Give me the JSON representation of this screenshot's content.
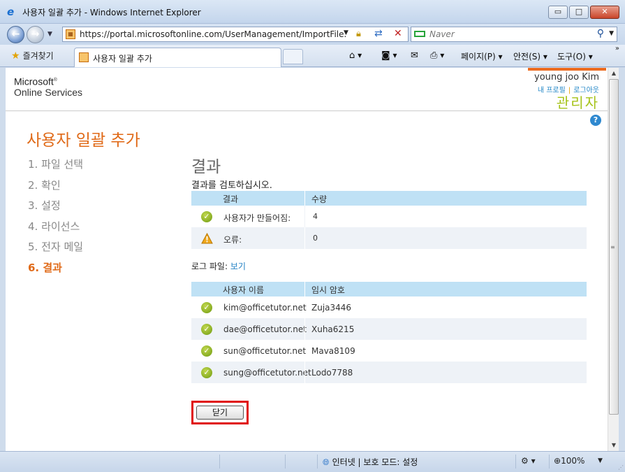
{
  "window": {
    "title": "사용자 일괄 추가 - Windows Internet Explorer",
    "minimize": "▭",
    "maximize": "□",
    "close": "✕"
  },
  "addressbar": {
    "url": "https://portal.microsoftonline.com/UserManagement/ImportFile.aspx",
    "search_placeholder": "Naver"
  },
  "favbar": {
    "favorites_label": "즐겨찾기",
    "tab_title": "사용자 일괄 추가",
    "page_menu": "페이지(P) ▾",
    "safety_menu": "안전(S) ▾",
    "tools_menu": "도구(O) ▾"
  },
  "header": {
    "logo_line1": "Microsoft",
    "logo_mark": "®",
    "logo_line2": "Online Services",
    "user_name": "young joo Kim",
    "profile_link": "내 프로필",
    "signout_link": "로그아웃",
    "role": "관리자",
    "help": "?"
  },
  "wizard": {
    "title": "사용자 일괄 추가",
    "steps": [
      {
        "label": "1. 파일 선택",
        "active": false
      },
      {
        "label": "2. 확인",
        "active": false
      },
      {
        "label": "3. 설정",
        "active": false
      },
      {
        "label": "4. 라이선스",
        "active": false
      },
      {
        "label": "5. 전자 메일",
        "active": false
      },
      {
        "label": "6. 결과",
        "active": true
      }
    ]
  },
  "results": {
    "title": "결과",
    "subtitle": "결과를 검토하십시오.",
    "summary": {
      "col_result": "결과",
      "col_count": "수량",
      "rows": [
        {
          "status": "ok",
          "label": "사용자가 만들어짐:",
          "count": "4"
        },
        {
          "status": "warning",
          "label": "오류:",
          "count": "0"
        }
      ]
    },
    "log_label": "로그 파일:",
    "log_link": "보기",
    "users": {
      "col_name": "사용자 이름",
      "col_password": "임시 암호",
      "rows": [
        {
          "name": "kim@officetutor.net",
          "password": "Zuja3446"
        },
        {
          "name": "dae@officetutor.net",
          "password": "Xuha6215"
        },
        {
          "name": "sun@officetutor.net",
          "password": "Mava8109"
        },
        {
          "name": "sung@officetutor.net",
          "password": "Lodo7788"
        }
      ]
    },
    "close_button": "닫기"
  },
  "statusbar": {
    "zone": "인터넷 | 보호 모드: 설정",
    "zoom": "100%"
  },
  "colors": {
    "accent_orange": "#e06a18",
    "role_green": "#a6c31a",
    "grid_header": "#bfe1f5",
    "highlight_red": "#e01010"
  }
}
